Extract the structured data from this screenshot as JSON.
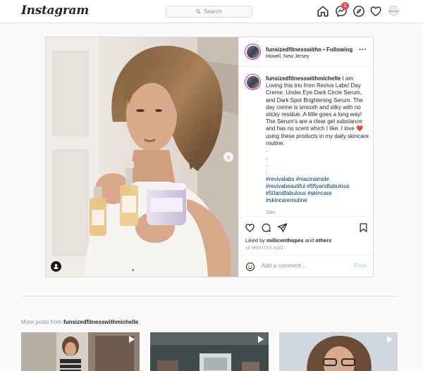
{
  "header": {
    "logo": "Instagram",
    "search_placeholder": "Search",
    "notification_count": "1",
    "profile_avatar_text": "Reviva"
  },
  "post": {
    "username": "funsizedfitnesswithmichelle",
    "username_truncated": "funsizedfitnesswithn",
    "separator": "•",
    "follow_label": "Following",
    "location": "Howell, New Jersey",
    "caption": "I am Loving this trio from Reviva Labs! Day Creme, Under Eye Dark Circle Serum, and Dark Spot Brightening Serum. The day creme is smooth and silky with no sticky residue. A little goes a long way! The Serum's are a clear gel substance and has no scent which I like. I love",
    "caption_heart": "❤️",
    "caption_end": "using these products in my daily skincare routine.",
    "caption_dots": [
      ".",
      ".",
      ".",
      "."
    ],
    "hashtags": [
      "#revivalabs",
      "#niacinamide",
      "#revivabeautiful",
      "#fiftyandfabulous",
      "#50andfabulous",
      "#skincare",
      "#skincareroutine"
    ],
    "caption_time": "19m",
    "liked_by_prefix": "Liked by",
    "liked_by_user": "millicenthopes",
    "liked_by_and": "and",
    "liked_by_others": "others",
    "posted_ago": "19 MINUTES AGO",
    "comment_placeholder": "Add a comment...",
    "post_button": "Post",
    "carousel_count": 3,
    "carousel_active": 1,
    "photo": {
      "jar_brand": "Reviva",
      "jar_label": "ANTIOXIDANT DAY CREME",
      "bottle1_label": "DARK SPOT SERUM",
      "bottle2_label": "DARK EYE CIRCLE SERUM"
    }
  },
  "more_posts": {
    "prefix": "More posts from",
    "username": "funsizedfitnesswithmichelle"
  },
  "colors": {
    "link_blue": "#00376b",
    "accent_blue": "#3897f0",
    "heart_red": "#ed4956",
    "border": "#dbdbdb",
    "post_disabled": "#b2dffc"
  }
}
